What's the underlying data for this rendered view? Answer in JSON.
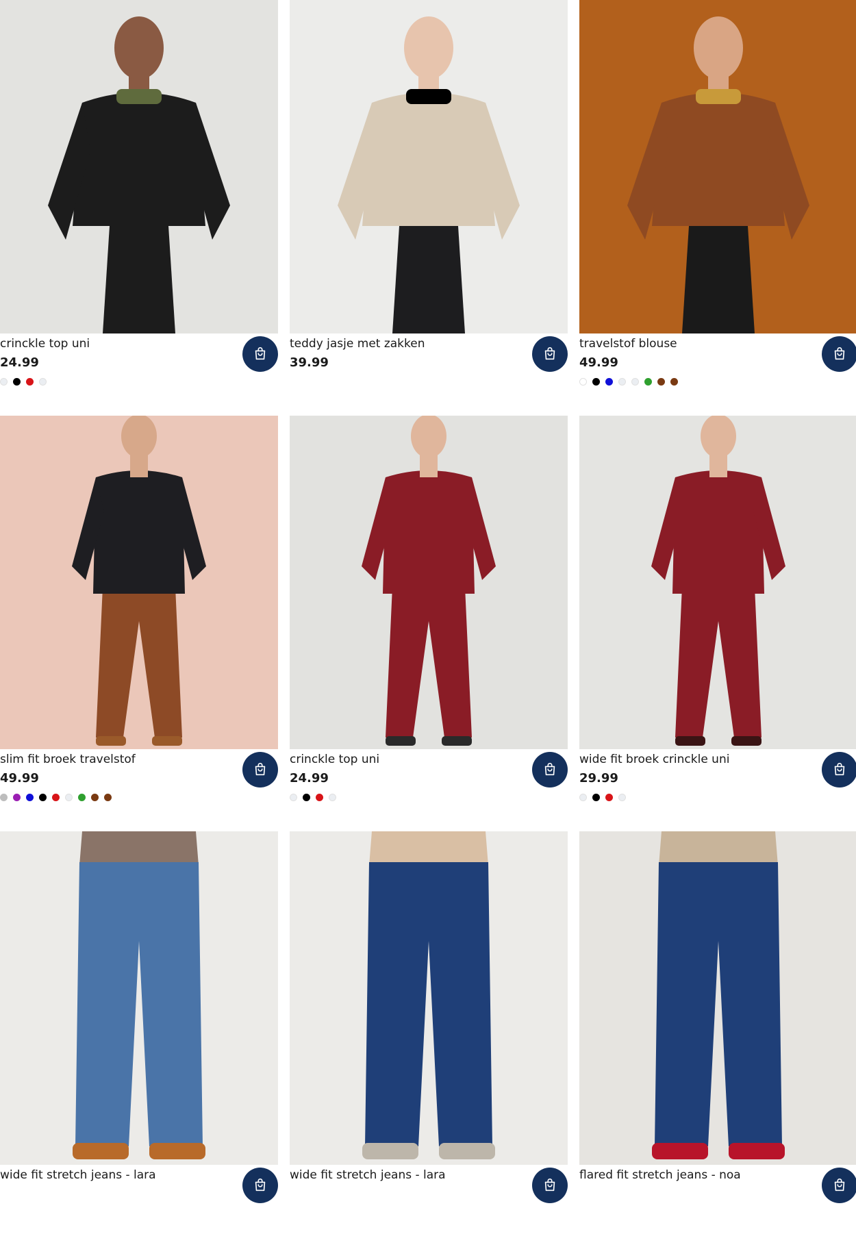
{
  "products": [
    {
      "title": "crinckle top uni",
      "price": "24.99",
      "swatches": [
        "#ebeef2",
        "#000000",
        "#d81418",
        "#ebeef2"
      ],
      "photo": {
        "bg": "#e3e3e0",
        "skin": "#8a5a43",
        "top": "#1c1c1c",
        "bottom": "#1c1c1c",
        "accent": "#5f6b3d"
      }
    },
    {
      "title": "teddy jasje met zakken",
      "price": "39.99",
      "swatches": [],
      "photo": {
        "bg": "#ececea",
        "skin": "#e7c4ad",
        "top": "#d8cab6",
        "bottom": "#1d1d1f",
        "accent": "#000000"
      }
    },
    {
      "title": "travelstof blouse",
      "price": "49.99",
      "swatches": [
        "#ffffff",
        "#000000",
        "#1010d8",
        "#ebeef2",
        "#ebeef2",
        "#2fa02f",
        "#7a3a12",
        "#7a3a12"
      ],
      "photo": {
        "bg": "#b2601c",
        "skin": "#d9a584",
        "top": "#8f4a22",
        "bottom": "#1a1a1a",
        "accent": "#c89a3a"
      }
    },
    {
      "title": "slim fit broek travelstof",
      "price": "49.99",
      "swatches": [
        "#bdbdbd",
        "#9b1fb3",
        "#1010d8",
        "#000000",
        "#d81418",
        "#ebeef2",
        "#2fa02f",
        "#7a3a12",
        "#7a3a12"
      ],
      "photo": {
        "bg": "#ebc7b9",
        "skin": "#d7a88a",
        "top": "#1e1e22",
        "bottom": "#8d4a26",
        "accent": "#9a5a2a"
      }
    },
    {
      "title": "crinckle top uni",
      "price": "24.99",
      "swatches": [
        "#ebeef2",
        "#000000",
        "#d81418",
        "#ebeef2"
      ],
      "photo": {
        "bg": "#e2e2df",
        "skin": "#e0b69c",
        "top": "#8a1c26",
        "bottom": "#8a1c26",
        "accent": "#2a2a2a"
      }
    },
    {
      "title": "wide fit broek crinckle uni",
      "price": "29.99",
      "swatches": [
        "#ebeef2",
        "#000000",
        "#d81418",
        "#ebeef2"
      ],
      "photo": {
        "bg": "#e4e4e1",
        "skin": "#e0b69c",
        "top": "#8a1c26",
        "bottom": "#8a1c26",
        "accent": "#3a1414"
      }
    },
    {
      "title": "wide fit stretch jeans - lara",
      "price": "",
      "swatches": [],
      "photo": {
        "bg": "#ecebe8",
        "skin": "#c89a80",
        "top": "#8a7468",
        "bottom": "#4a74a8",
        "accent": "#b86a2a"
      }
    },
    {
      "title": "wide fit stretch jeans - lara",
      "price": "",
      "swatches": [],
      "photo": {
        "bg": "#ecebe8",
        "skin": "#e0b69c",
        "top": "#d9bfa4",
        "bottom": "#1f3f78",
        "accent": "#bdb6aa"
      }
    },
    {
      "title": "flared fit stretch jeans - noa",
      "price": "",
      "swatches": [],
      "photo": {
        "bg": "#e6e4e0",
        "skin": "#e0b69c",
        "top": "#c8b49a",
        "bottom": "#1f3f78",
        "accent": "#b8142a"
      }
    }
  ]
}
